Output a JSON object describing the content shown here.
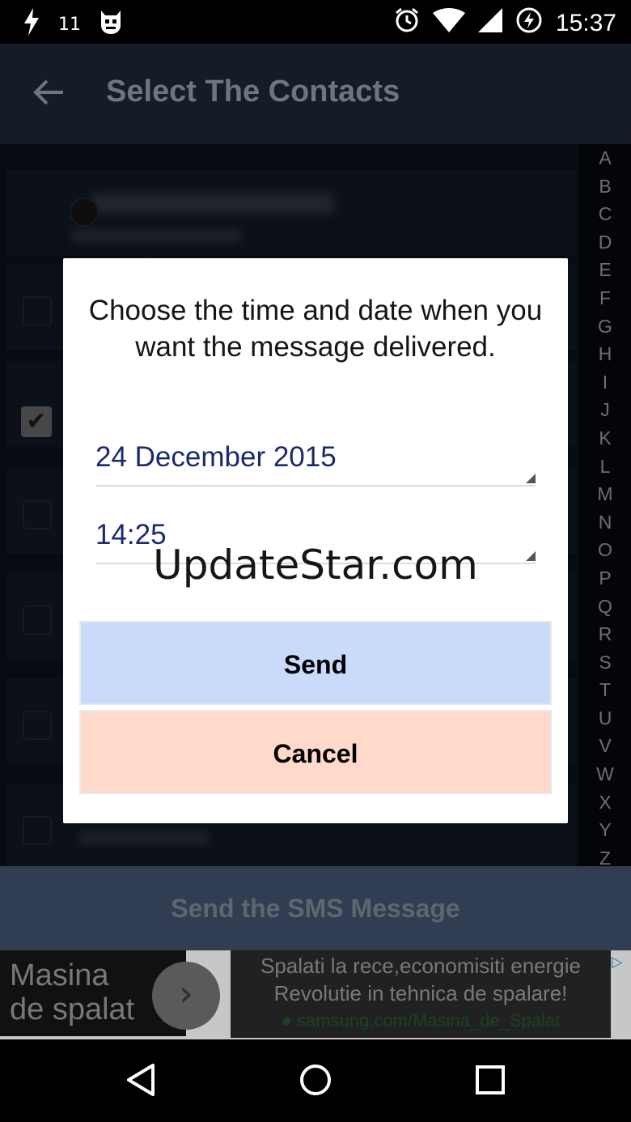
{
  "status_bar": {
    "notif_count": "11",
    "time": "15:37"
  },
  "toolbar": {
    "title": "Select The Contacts"
  },
  "index_letters": [
    "A",
    "B",
    "C",
    "D",
    "E",
    "F",
    "G",
    "H",
    "I",
    "J",
    "K",
    "L",
    "M",
    "N",
    "O",
    "P",
    "Q",
    "R",
    "S",
    "T",
    "U",
    "V",
    "W",
    "X",
    "Y",
    "Z"
  ],
  "contacts": [
    {
      "name": "",
      "phone": "",
      "checked": false
    },
    {
      "name": "",
      "phone": "",
      "checked": false
    },
    {
      "name": "",
      "phone": "",
      "checked": true
    },
    {
      "name": "",
      "phone": "",
      "checked": false
    },
    {
      "name": "",
      "phone": "",
      "checked": false
    },
    {
      "name": "",
      "phone": "",
      "checked": false
    },
    {
      "name": "",
      "phone": "",
      "checked": false
    },
    {
      "name": "",
      "phone": "",
      "checked": false
    }
  ],
  "send_bar": {
    "label": "Send the SMS Message"
  },
  "ad": {
    "brand_line1": "Masina",
    "brand_line2": "de spalat",
    "headline": "Spalati la rece,economisiti energie",
    "subline": "Revolutie in tehnica de spalare!",
    "url": "samsung.com/Masina_de_Spalat"
  },
  "dialog": {
    "message": "Choose the time and date when you want the message delivered.",
    "date_value": "24 December 2015",
    "time_value": "14:25",
    "watermark": "UpdateStar.com",
    "send_label": "Send",
    "cancel_label": "Cancel"
  },
  "colors": {
    "toolbar_bg": "#1c2534",
    "send_bar_bg": "#3e4f69",
    "field_text": "#1a2a6e",
    "send_button_bg": "#c9dafb",
    "cancel_button_bg": "#ffd9c9"
  }
}
